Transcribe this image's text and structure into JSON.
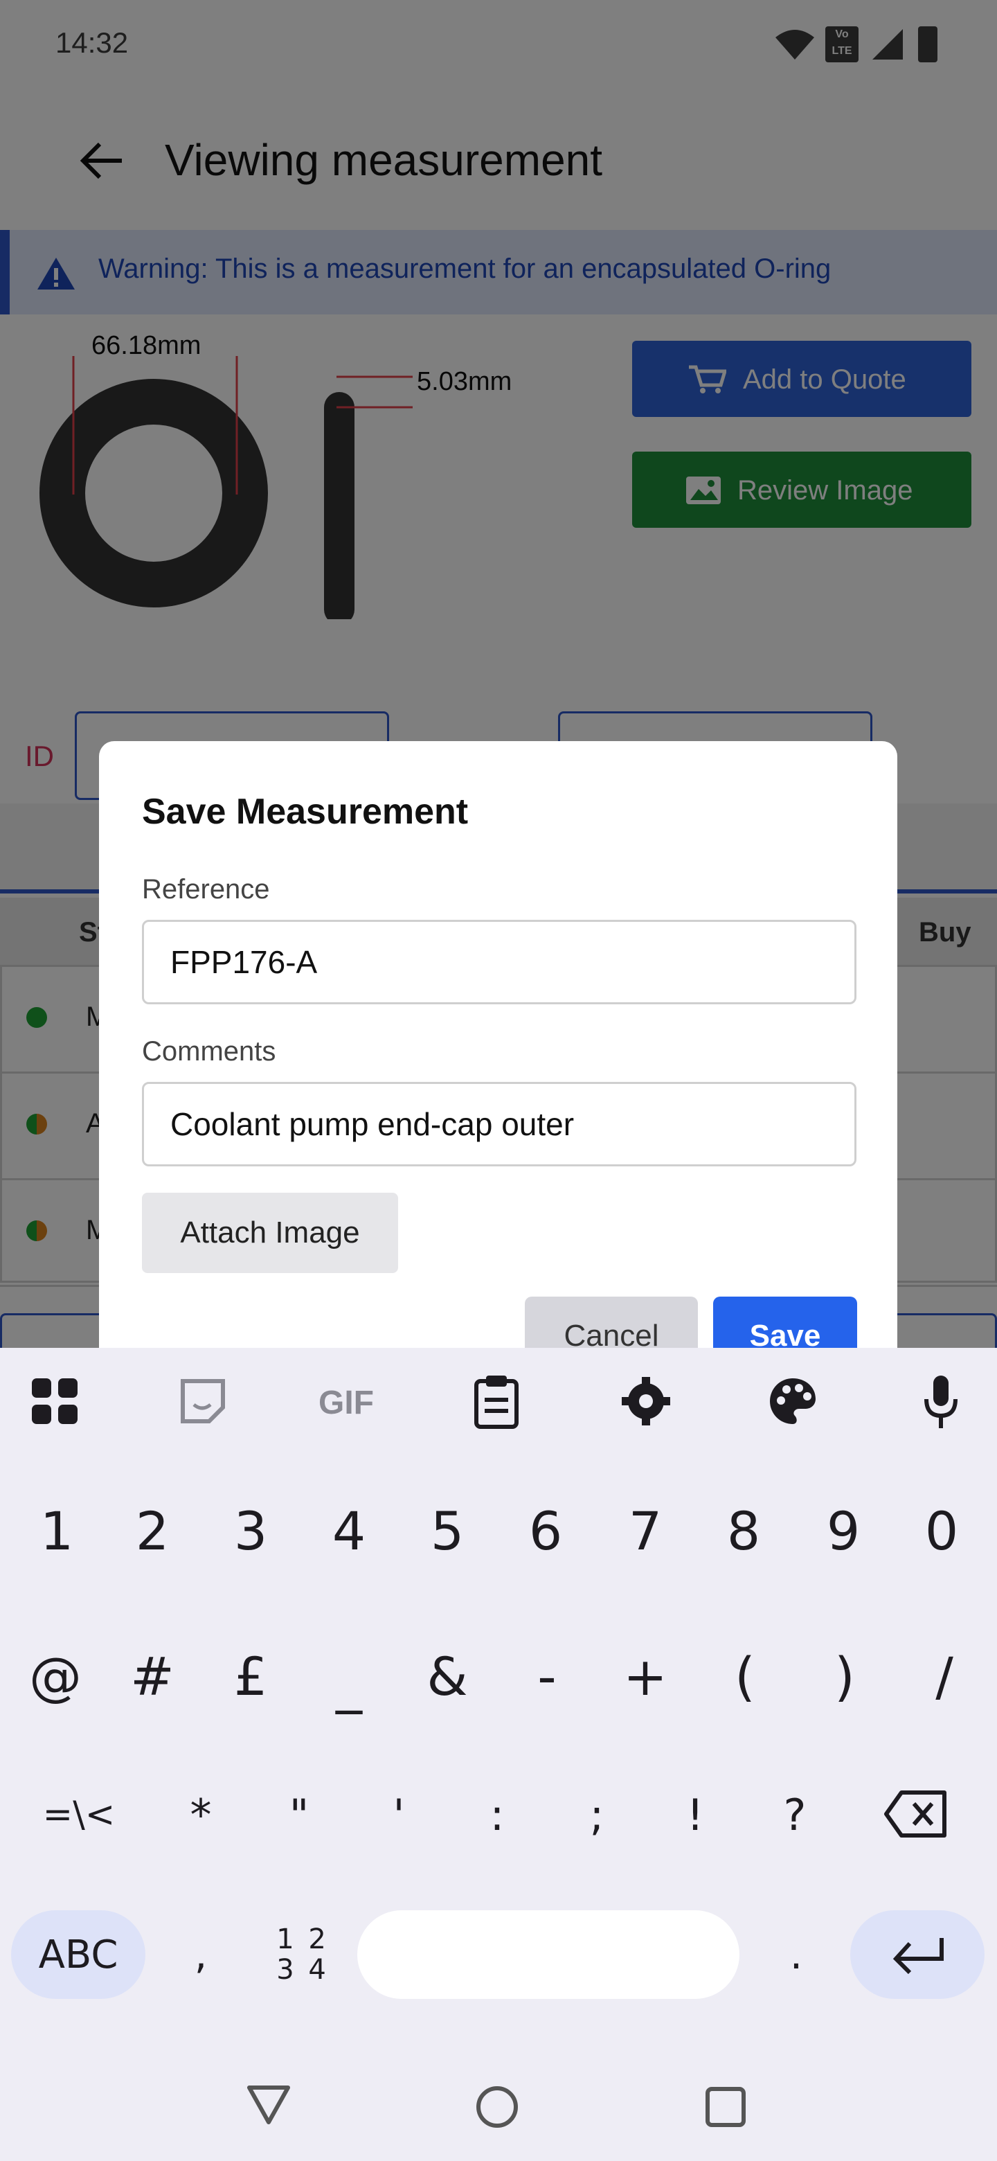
{
  "status_bar": {
    "time": "14:32",
    "volte_label": "Vo LTE"
  },
  "app_bar": {
    "title": "Viewing measurement"
  },
  "banner": {
    "text": "Warning: This is a measurement for an encapsulated O-ring"
  },
  "diagram": {
    "inner_diameter": "66.18mm",
    "cross_section": "5.03mm"
  },
  "actions": {
    "add_to_quote": "Add to Quote",
    "review_image": "Review Image"
  },
  "fields": {
    "id_label": "ID"
  },
  "table": {
    "headers": {
      "status_partial": "St",
      "buy": "Buy"
    },
    "rows": [
      {
        "status_color": "#1fa134",
        "text_partial": "M"
      },
      {
        "status_color": "#d9831f",
        "text_partial": "A"
      },
      {
        "status_color": "#d9831f",
        "text_partial": "M"
      }
    ]
  },
  "dialog": {
    "title": "Save Measurement",
    "reference_label": "Reference",
    "reference_value": "FPP176-A",
    "comments_label": "Comments",
    "comments_value": "Coolant pump end-cap outer",
    "attach_label": "Attach Image",
    "cancel_label": "Cancel",
    "save_label": "Save"
  },
  "keyboard": {
    "toolbar": [
      "apps-icon",
      "sticker-icon",
      "gif-icon",
      "clipboard-icon",
      "settings-icon",
      "palette-icon",
      "microphone-icon"
    ],
    "gif_label": "GIF",
    "row1": [
      "1",
      "2",
      "3",
      "4",
      "5",
      "6",
      "7",
      "8",
      "9",
      "0"
    ],
    "row2": [
      "@",
      "#",
      "£",
      "_",
      "&",
      "-",
      "+",
      "(",
      ")",
      "/"
    ],
    "row3": [
      "=\\<",
      "*",
      "\"",
      "'",
      ":",
      ";",
      "!",
      "?"
    ],
    "abc_label": "ABC",
    "comma": ",",
    "numpad_label": "1 2 3 4",
    "period": "."
  },
  "colors": {
    "primary_blue": "#2563eb",
    "success_green": "#1f8f3b",
    "warning_blue": "#1f47b7",
    "id_red": "#d2325b"
  }
}
